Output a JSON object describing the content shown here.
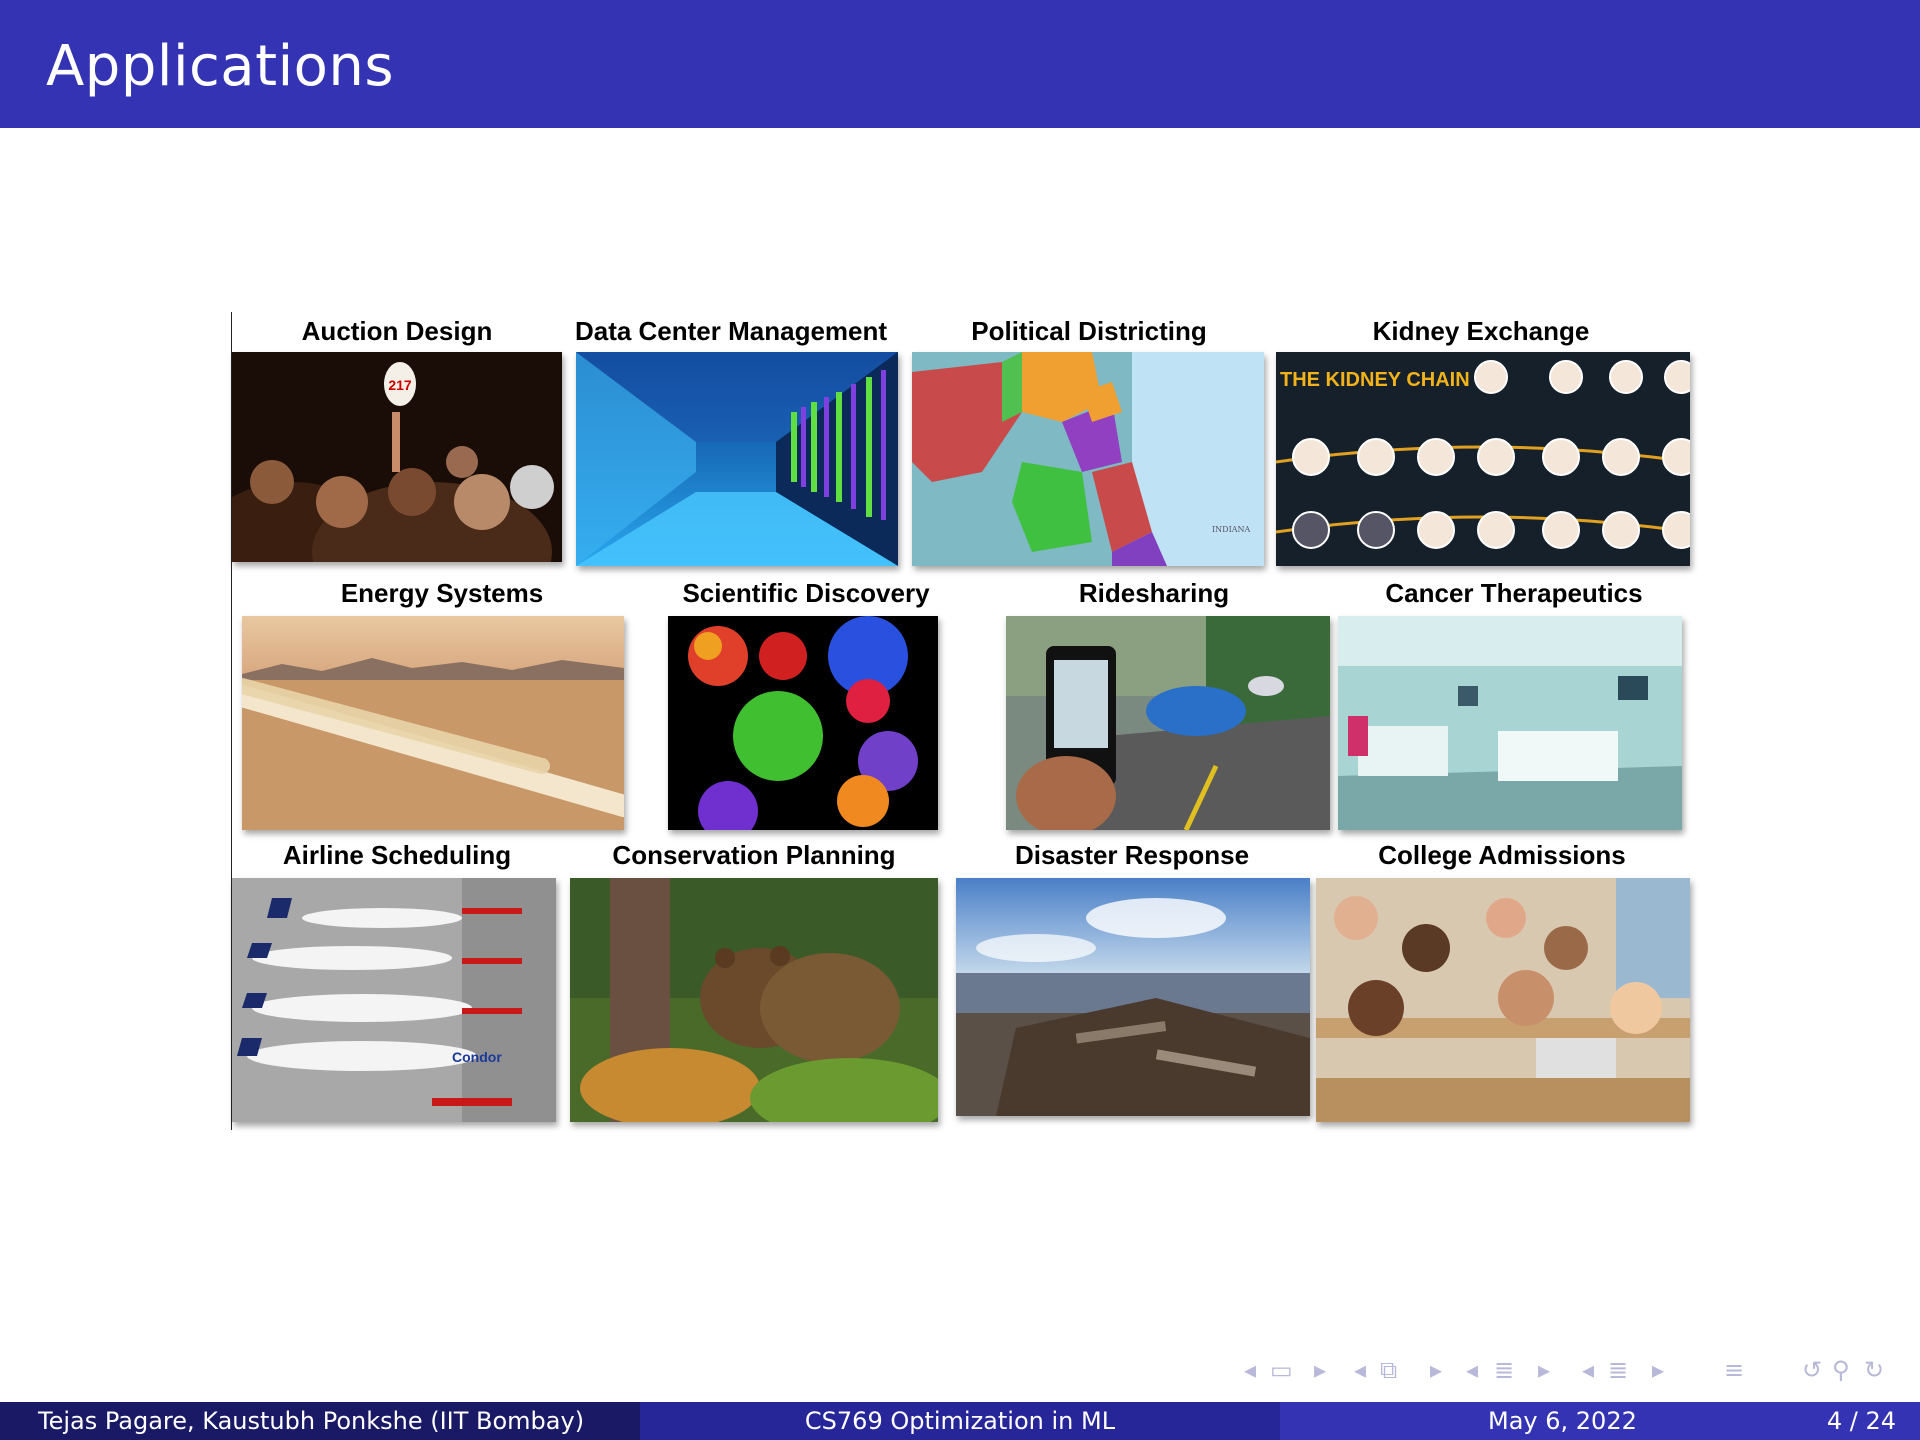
{
  "slide": {
    "title": "Applications",
    "panels": [
      {
        "caption": "Auction Design"
      },
      {
        "caption": "Data Center Management"
      },
      {
        "caption": "Political Districting"
      },
      {
        "caption": "Kidney Exchange"
      },
      {
        "caption": "Energy Systems"
      },
      {
        "caption": "Scientific Discovery"
      },
      {
        "caption": "Ridesharing"
      },
      {
        "caption": "Cancer Therapeutics"
      },
      {
        "caption": "Airline Scheduling"
      },
      {
        "caption": "Conservation Planning"
      },
      {
        "caption": "Disaster Response"
      },
      {
        "caption": "College Admissions"
      }
    ],
    "image_text": {
      "kidney_heading": "THE KIDNEY CHAIN",
      "paddle_number": "217",
      "airline_logo": "Condor",
      "map_label": "INDIANA"
    }
  },
  "footer": {
    "authors": "Tejas Pagare, Kaustubh Ponkshe  (IIT Bombay)",
    "course": "CS769 Optimization in ML",
    "date": "May 6, 2022",
    "page": "4 / 24"
  },
  "nav_icons": [
    "frame-prev-icon",
    "frame-icon",
    "frame-next-icon",
    "subsection-prev-icon",
    "subsection-icon",
    "subsection-next-icon",
    "section-prev-icon",
    "section-icon",
    "section-next-icon",
    "align-icon",
    "back-icon",
    "search-icon",
    "forward-icon"
  ],
  "colors": {
    "header": "#3333b3",
    "footer_left": "#191966",
    "footer_mid": "#262699",
    "footer_right": "#3333b3"
  }
}
